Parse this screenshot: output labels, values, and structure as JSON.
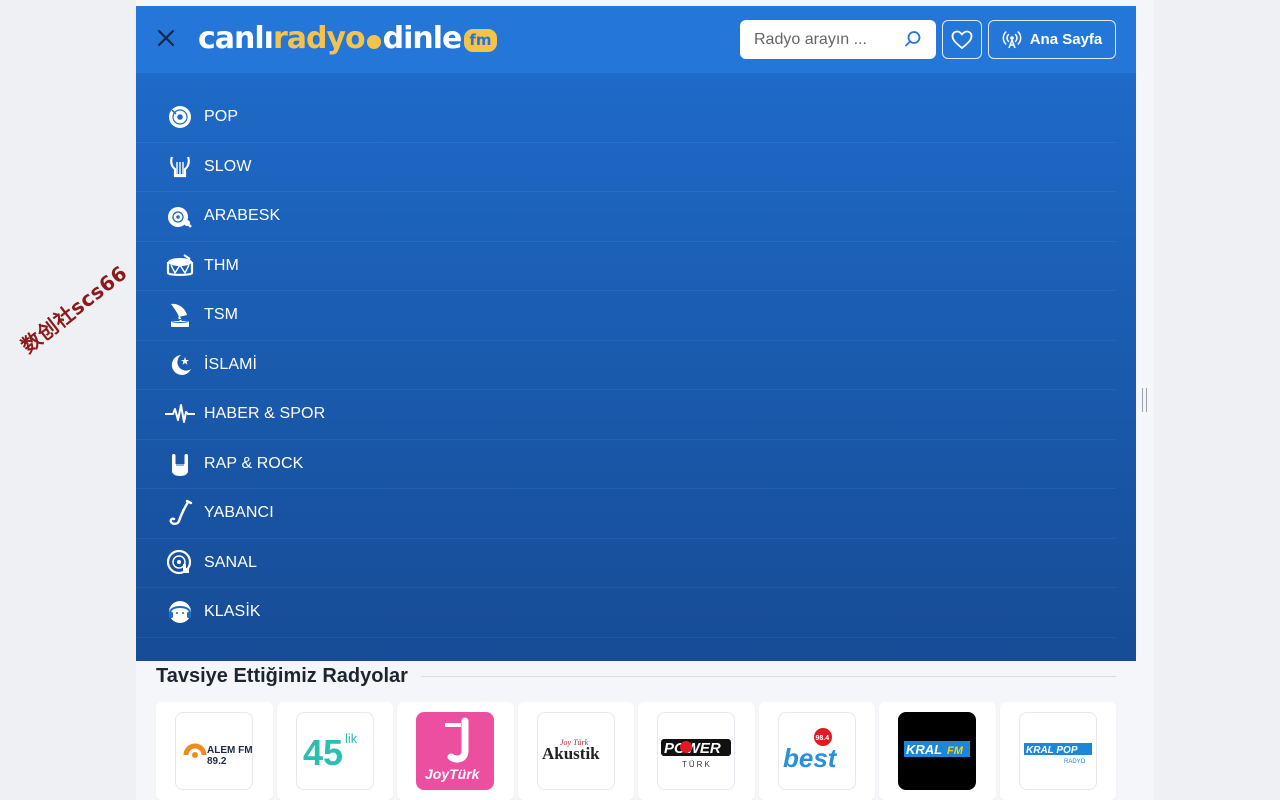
{
  "watermark": "数创社scs66",
  "header": {
    "logo": {
      "part1": "canlı",
      "part2": "radyo",
      "part3": "dinle",
      "badge": "fm"
    },
    "search": {
      "placeholder": "Radyo arayın ..."
    },
    "home_label": "Ana Sayfa",
    "colors": {
      "header_bg": "#2477d8",
      "accent": "#f6c34a"
    }
  },
  "menu": {
    "items": [
      {
        "label": "POP",
        "icon": "vinyl-icon"
      },
      {
        "label": "SLOW",
        "icon": "lyre-icon"
      },
      {
        "label": "ARABESK",
        "icon": "baglama-icon"
      },
      {
        "label": "THM",
        "icon": "drum-icon"
      },
      {
        "label": "TSM",
        "icon": "gramophone-icon"
      },
      {
        "label": "İSLAMİ",
        "icon": "crescent-star-icon"
      },
      {
        "label": "HABER & SPOR",
        "icon": "pulse-icon"
      },
      {
        "label": "RAP & ROCK",
        "icon": "rock-hand-icon"
      },
      {
        "label": "YABANCI",
        "icon": "saxophone-icon"
      },
      {
        "label": "SANAL",
        "icon": "dj-disc-icon"
      },
      {
        "label": "KLASİK",
        "icon": "headphones-face-icon"
      }
    ]
  },
  "recommended": {
    "title": "Tavsiye Ettiğimiz Radyolar",
    "stations": [
      {
        "name": "ALEM FM",
        "sub": "89.2"
      },
      {
        "name": "45",
        "sub": "lik"
      },
      {
        "name": "JoyTürk",
        "sub": ""
      },
      {
        "name": "Akustik",
        "sub": "Joy Türk"
      },
      {
        "name": "POWER",
        "sub": "TÜRK"
      },
      {
        "name": "best",
        "sub": "98.4"
      },
      {
        "name": "KRAL",
        "sub": "FM"
      },
      {
        "name": "KRAL POP",
        "sub": "RADYO"
      }
    ]
  }
}
